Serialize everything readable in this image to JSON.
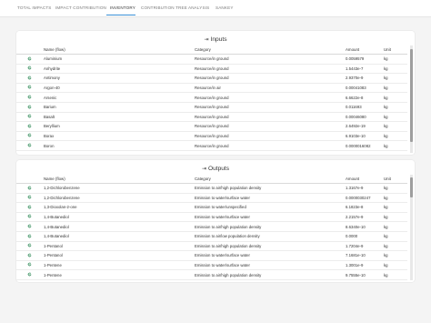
{
  "tabs": [
    {
      "label": "TOTAL IMPACTS"
    },
    {
      "label": "IMPACT CONTRIBUTION"
    },
    {
      "label": "INVENTORY"
    },
    {
      "label": "CONTRIBUTION TREE"
    },
    {
      "label": "ANALYSIS"
    },
    {
      "label": "SANKEY"
    }
  ],
  "active_tab": "INVENTORY",
  "accent_color": "#3a8fd6",
  "inputs": {
    "title": "Inputs",
    "icon": "sign-in-icon",
    "columns": {
      "name": "Name (flow)",
      "category": "Category",
      "amount": "Amount",
      "unit": "Unit"
    },
    "rows": [
      {
        "name": "Aluminium",
        "category": "Resource/in ground",
        "amount": "0.0059579",
        "unit": "kg"
      },
      {
        "name": "Anhydrite",
        "category": "Resource/in ground",
        "amount": "1.5443e-7",
        "unit": "kg"
      },
      {
        "name": "Antimony",
        "category": "Resource/in ground",
        "amount": "2.9370e-9",
        "unit": "kg"
      },
      {
        "name": "Argon-40",
        "category": "Resource/in air",
        "amount": "0.00041083",
        "unit": "kg"
      },
      {
        "name": "Arsenic",
        "category": "Resource/in ground",
        "amount": "6.6622e-8",
        "unit": "kg"
      },
      {
        "name": "Barium",
        "category": "Resource/in ground",
        "amount": "0.011693",
        "unit": "kg"
      },
      {
        "name": "Basalt",
        "category": "Resource/in ground",
        "amount": "0.00046080",
        "unit": "kg"
      },
      {
        "name": "Beryllium",
        "category": "Resource/in ground",
        "amount": "2.6492e-19",
        "unit": "kg"
      },
      {
        "name": "Borax",
        "category": "Resource/in ground",
        "amount": "6.9103e-10",
        "unit": "kg"
      },
      {
        "name": "Boron",
        "category": "Resource/in ground",
        "amount": "0.0000016082",
        "unit": "kg"
      }
    ]
  },
  "outputs": {
    "title": "Outputs",
    "icon": "sign-out-icon",
    "columns": {
      "name": "Name (flow)",
      "category": "Category",
      "amount": "Amount",
      "unit": "Unit"
    },
    "rows": [
      {
        "name": "1,2-Dichlorobenzene",
        "category": "Emission to air/high population density",
        "amount": "1.3167e-9",
        "unit": "kg"
      },
      {
        "name": "1,2-Dichlorobenzene",
        "category": "Emission to water/surface water",
        "amount": "0.0000030247",
        "unit": "kg"
      },
      {
        "name": "1,3-Dioxolan-2-one",
        "category": "Emission to water/unspecified",
        "amount": "6.1823e-8",
        "unit": "kg"
      },
      {
        "name": "1,4-Butanediol",
        "category": "Emission to water/surface water",
        "amount": "2.2157e-9",
        "unit": "kg"
      },
      {
        "name": "1,4-Butanediol",
        "category": "Emission to air/high population density",
        "amount": "8.6340e-10",
        "unit": "kg"
      },
      {
        "name": "1,4-Butanediol",
        "category": "Emission to air/low population density",
        "amount": "0.0000",
        "unit": "kg"
      },
      {
        "name": "1-Pentanol",
        "category": "Emission to air/high population density",
        "amount": "1.7204e-9",
        "unit": "kg"
      },
      {
        "name": "1-Pentanol",
        "category": "Emission to water/surface water",
        "amount": "7.1681e-10",
        "unit": "kg"
      },
      {
        "name": "1-Pentene",
        "category": "Emission to water/surface water",
        "amount": "1.3001e-9",
        "unit": "kg"
      },
      {
        "name": "1-Pentene",
        "category": "Emission to air/high population density",
        "amount": "9.7555e-10",
        "unit": "kg"
      }
    ]
  }
}
